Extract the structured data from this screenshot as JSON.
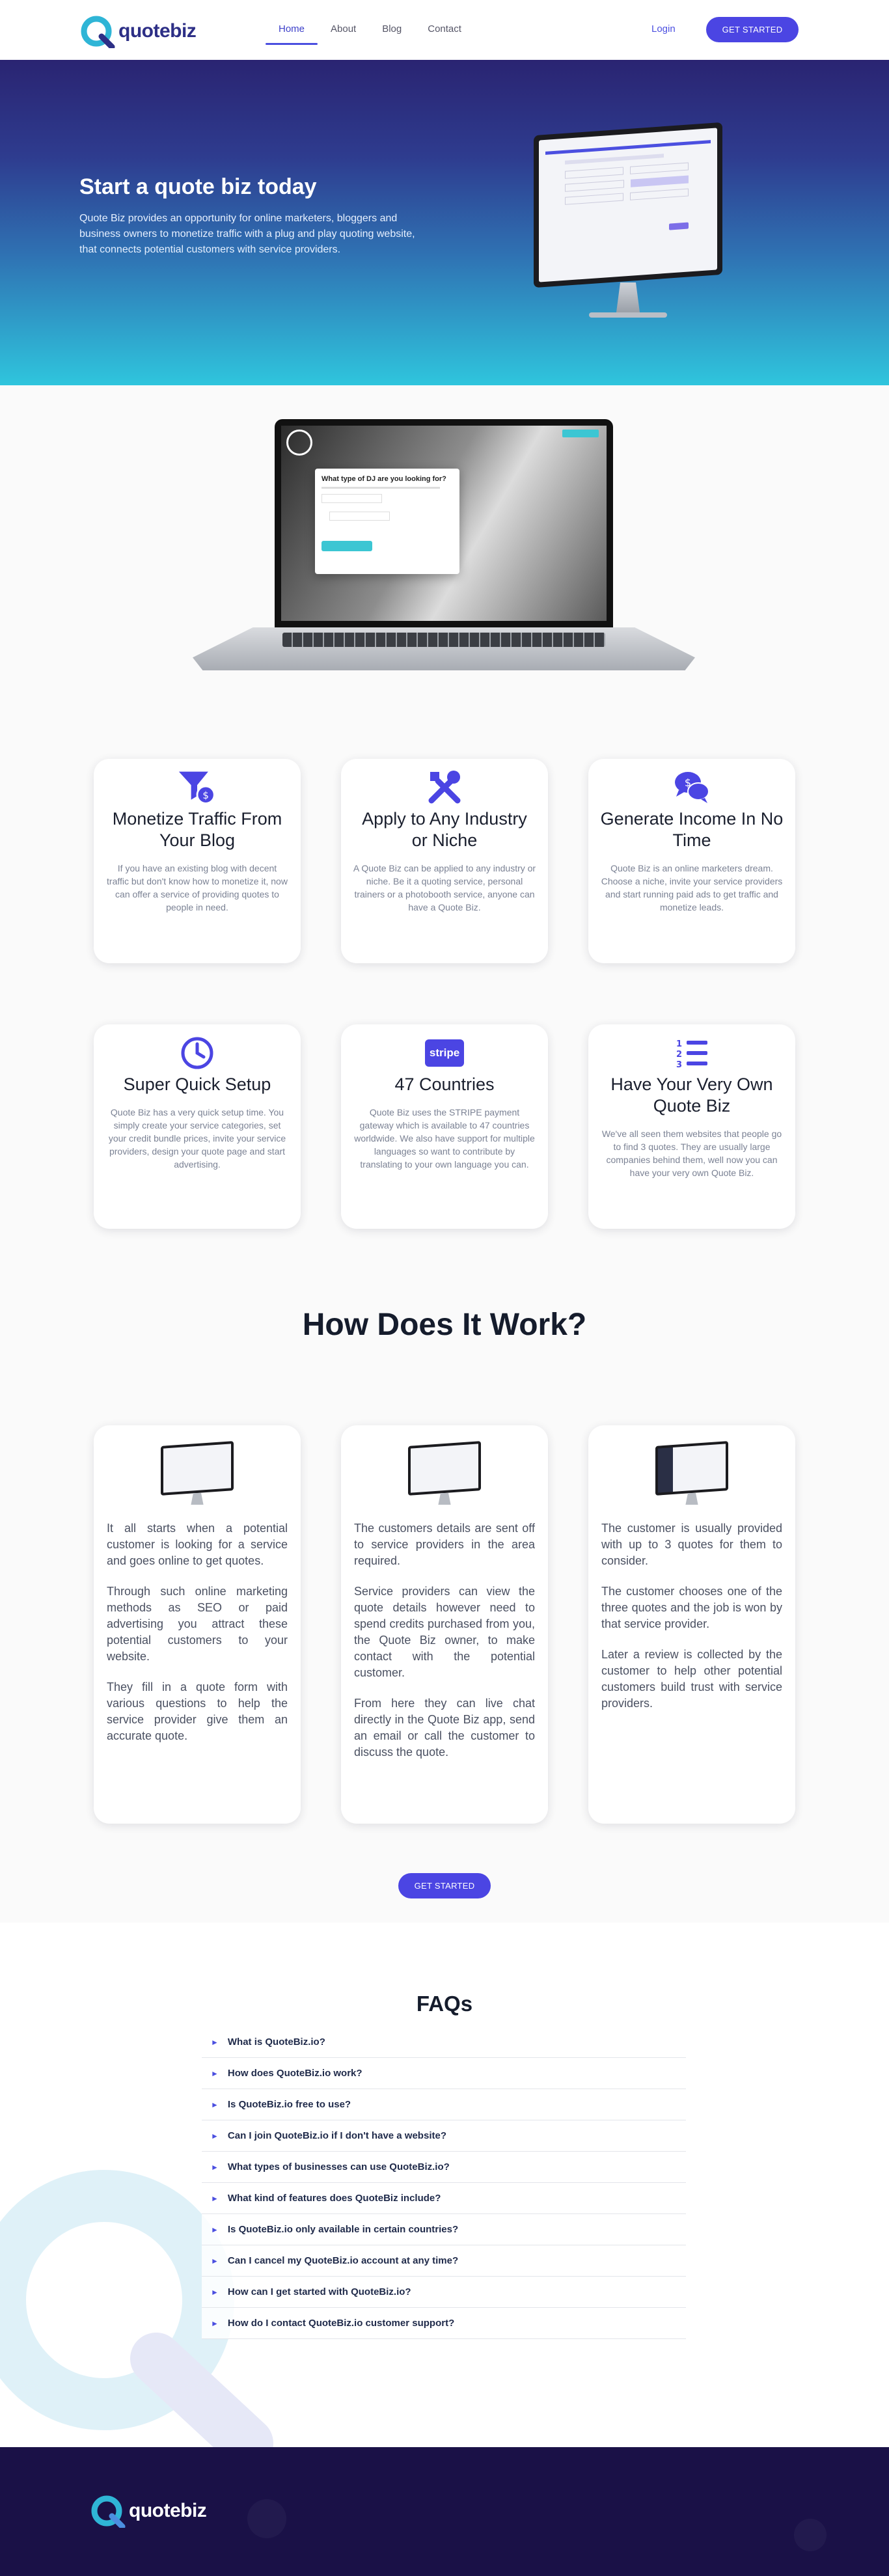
{
  "brand": {
    "name": "quotebiz",
    "logo_primary": "#2d2f86",
    "logo_accent": "#2fb5d6"
  },
  "nav": {
    "items": [
      {
        "label": "Home",
        "active": true
      },
      {
        "label": "About",
        "active": false
      },
      {
        "label": "Blog",
        "active": false
      },
      {
        "label": "Contact",
        "active": false
      }
    ],
    "login_label": "Login",
    "cta_label": "GET STARTED"
  },
  "hero": {
    "title": "Start a quote biz today",
    "description": "Quote Biz provides an opportunity for online marketers, bloggers and business owners to monetize traffic with a plug and play quoting website, that connects potential customers with service providers.",
    "gradient_top": "#2a2472",
    "gradient_bottom": "#2fc5dd"
  },
  "laptop_preview": {
    "dialog_title": "What type of DJ are you looking for?"
  },
  "features": [
    {
      "icon": "funnel-dollar-icon",
      "title": "Monetize Traffic From Your Blog",
      "text": "If you have an existing blog with decent traffic but don't know how to monetize it, now can offer a service of providing quotes to people in need."
    },
    {
      "icon": "tools-icon",
      "title": "Apply to Any Industry or Niche",
      "text": "A Quote Biz can be applied to any industry or niche. Be it a quoting service, personal trainers or a photobooth service, anyone can have a Quote Biz."
    },
    {
      "icon": "chat-dollar-icon",
      "title": "Generate Income In No Time",
      "text": "Quote Biz is an online marketers dream. Choose a niche, invite your service providers and start running paid ads to get traffic and monetize leads."
    },
    {
      "icon": "clock-icon",
      "title": "Super Quick Setup",
      "text": "Quote Biz has a very quick setup time. You simply create your service categories, set your credit bundle prices, invite your service providers, design your quote page and start advertising."
    },
    {
      "icon": "stripe-icon",
      "icon_text": "stripe",
      "title": "47 Countries",
      "text": "Quote Biz uses the STRIPE payment gateway which is available to 47 countries worldwide. We also have support for multiple languages so want to contribute by translating to your own language you can."
    },
    {
      "icon": "numbered-list-icon",
      "title": "Have Your Very Own Quote Biz",
      "text": "We've all seen them websites that people go to find 3 quotes. They are usually large companies behind them, well now you can have your very own Quote Biz."
    }
  ],
  "how": {
    "title": "How Does It Work?",
    "cards": [
      {
        "paragraphs": [
          "It all starts when a potential customer is looking for a service and goes online to get quotes.",
          "Through such online marketing methods as SEO or paid advertising you attract these potential customers to your website.",
          "They fill in a quote form with various questions to help the service provider give them an accurate quote."
        ]
      },
      {
        "paragraphs": [
          "The customers details are sent off to service providers in the area required.",
          "Service providers can view the quote details however need to spend credits purchased from you, the Quote Biz owner, to make contact with the potential customer.",
          "From here they can live chat directly in the Quote Biz app, send an email or call the customer to discuss the quote."
        ]
      },
      {
        "paragraphs": [
          "The customer is usually provided with up to 3 quotes for them to consider.",
          "The customer chooses one of the three quotes and the job is won by that service provider.",
          "Later a review is collected by the customer to help other potential customers build trust with service providers."
        ]
      }
    ],
    "cta_label": "GET STARTED"
  },
  "faq": {
    "title": "FAQs",
    "items": [
      "What is QuoteBiz.io?",
      "How does QuoteBiz.io work?",
      "Is QuoteBiz.io free to use?",
      "Can I join QuoteBiz.io if I don't have a website?",
      "What types of businesses can use QuoteBiz.io?",
      "What kind of features does QuoteBiz include?",
      "Is QuoteBiz.io only available in certain countries?",
      "Can I cancel my QuoteBiz.io account at any time?",
      "How can I get started with QuoteBiz.io?",
      "How do I contact QuoteBiz.io customer support?"
    ]
  },
  "footer": {
    "background": "#1a1147"
  },
  "accent_color": "#4b45e3"
}
